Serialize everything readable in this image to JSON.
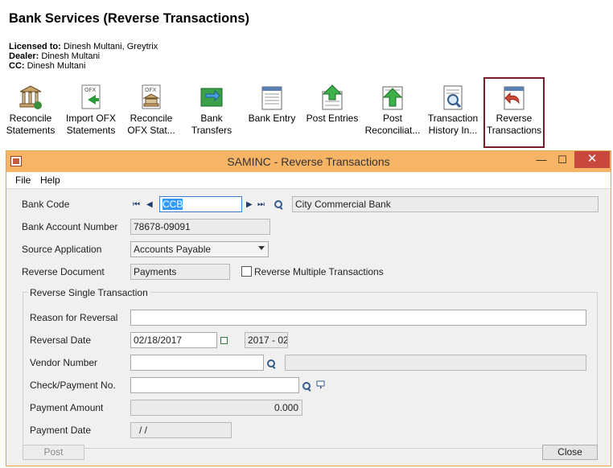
{
  "header": {
    "title": "Bank Services (Reverse Transactions)",
    "licensed_to_label": "Licensed to:",
    "licensed_to_value": "Dinesh Multani, Greytrix",
    "dealer_label": "Dealer:",
    "dealer_value": "Dinesh Multani",
    "cc_label": "CC:",
    "cc_value": "Dinesh Multani"
  },
  "toolbar": {
    "tiles": [
      {
        "line1": "Reconcile",
        "line2": "Statements",
        "icon": "reconcile-statements-icon"
      },
      {
        "line1": "Import OFX",
        "line2": "Statements",
        "icon": "import-ofx-icon"
      },
      {
        "line1": "Reconcile",
        "line2": "OFX Stat...",
        "icon": "reconcile-ofx-icon"
      },
      {
        "line1": "Bank",
        "line2": "Transfers",
        "icon": "bank-transfers-icon"
      },
      {
        "line1": "Bank Entry",
        "line2": "",
        "icon": "bank-entry-icon"
      },
      {
        "line1": "Post Entries",
        "line2": "",
        "icon": "post-entries-icon"
      },
      {
        "line1": "Post",
        "line2": "Reconciliat...",
        "icon": "post-reconciliation-icon"
      },
      {
        "line1": "Transaction",
        "line2": "History In...",
        "icon": "transaction-history-icon"
      },
      {
        "line1": "Reverse",
        "line2": "Transactions",
        "icon": "reverse-transactions-icon"
      }
    ]
  },
  "window": {
    "title": "SAMINC - Reverse Transactions",
    "minimize": "—",
    "maximize": "☐",
    "close": "✕",
    "menu": {
      "file": "File",
      "help": "Help"
    }
  },
  "form": {
    "bank_code_label": "Bank Code",
    "bank_code_value": "CCB",
    "bank_name": "City Commercial Bank",
    "bank_account_label": "Bank Account Number",
    "bank_account_value": "78678-09091",
    "source_app_label": "Source Application",
    "source_app_value": "Accounts Payable",
    "reverse_doc_label": "Reverse Document",
    "reverse_doc_value": "Payments",
    "reverse_multiple_label": "Reverse Multiple Transactions",
    "group_title": "Reverse Single Transaction",
    "reason_label": "Reason for Reversal",
    "reason_value": "",
    "reversal_date_label": "Reversal Date",
    "reversal_date_value": "02/18/2017",
    "period_value": "2017 - 02",
    "vendor_label": "Vendor Number",
    "vendor_value": "",
    "vendor_name": "",
    "check_label": "Check/Payment No.",
    "check_value": "",
    "amount_label": "Payment Amount",
    "amount_value": "0.000",
    "payment_date_label": "Payment Date",
    "payment_date_value": " /  /"
  },
  "buttons": {
    "post": "Post",
    "close": "Close"
  },
  "colors": {
    "titlebar": "#f6b467",
    "selected_tile_border": "#7b1a2a",
    "close_button": "#c9483d"
  }
}
